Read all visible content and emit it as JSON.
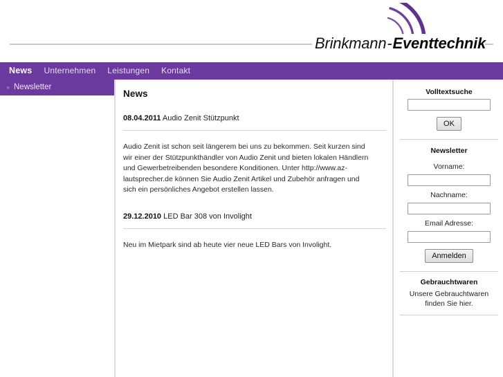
{
  "header": {
    "logo": {
      "name_part1": "Brinkmann",
      "separator": "-",
      "name_part2": "Eventtechnik",
      "arcs_icon": "signal-arcs-icon",
      "accent_color": "#6a3a9e"
    }
  },
  "nav": {
    "items": [
      {
        "label": "News",
        "active": true
      },
      {
        "label": "Unternehmen",
        "active": false
      },
      {
        "label": "Leistungen",
        "active": false
      },
      {
        "label": "Kontakt",
        "active": false
      }
    ]
  },
  "subnav": {
    "arrow": "››",
    "items": [
      {
        "label": "Newsletter"
      }
    ]
  },
  "main": {
    "title": "News",
    "news": [
      {
        "date": "08.04.2011",
        "headline": "Audio Zenit Stützpunkt",
        "body": "Audio Zenit ist schon seit längerem bei uns zu bekommen. Seit kurzen sind wir einer der Stützpunkthändler von Audio Zenit und bieten lokalen Händlern und Gewerbetreibenden besondere Konditionen. Unter http://www.az-lautsprecher.de können Sie Audio Zenit Artikel und Zubehör anfragen und sich ein persönliches Angebot erstellen lassen."
      },
      {
        "date": "29.12.2010",
        "headline": "LED Bar 308 von Involight",
        "body": "Neu im Mietpark sind ab heute vier neue LED Bars von Involight."
      }
    ]
  },
  "sidebar": {
    "search": {
      "title": "Volltextsuche",
      "value": "",
      "placeholder": "",
      "button_label": "OK"
    },
    "newsletter": {
      "title": "Newsletter",
      "fields": [
        {
          "label": "Vorname:",
          "value": "",
          "placeholder": ""
        },
        {
          "label": "Nachname:",
          "value": "",
          "placeholder": ""
        },
        {
          "label": "Email Adresse:",
          "value": "",
          "placeholder": ""
        }
      ],
      "button_label": "Anmelden"
    },
    "gebrauchtwaren": {
      "title": "Gebrauchtwaren",
      "text": "Unsere Gebrauchtwaren finden Sie hier."
    }
  }
}
